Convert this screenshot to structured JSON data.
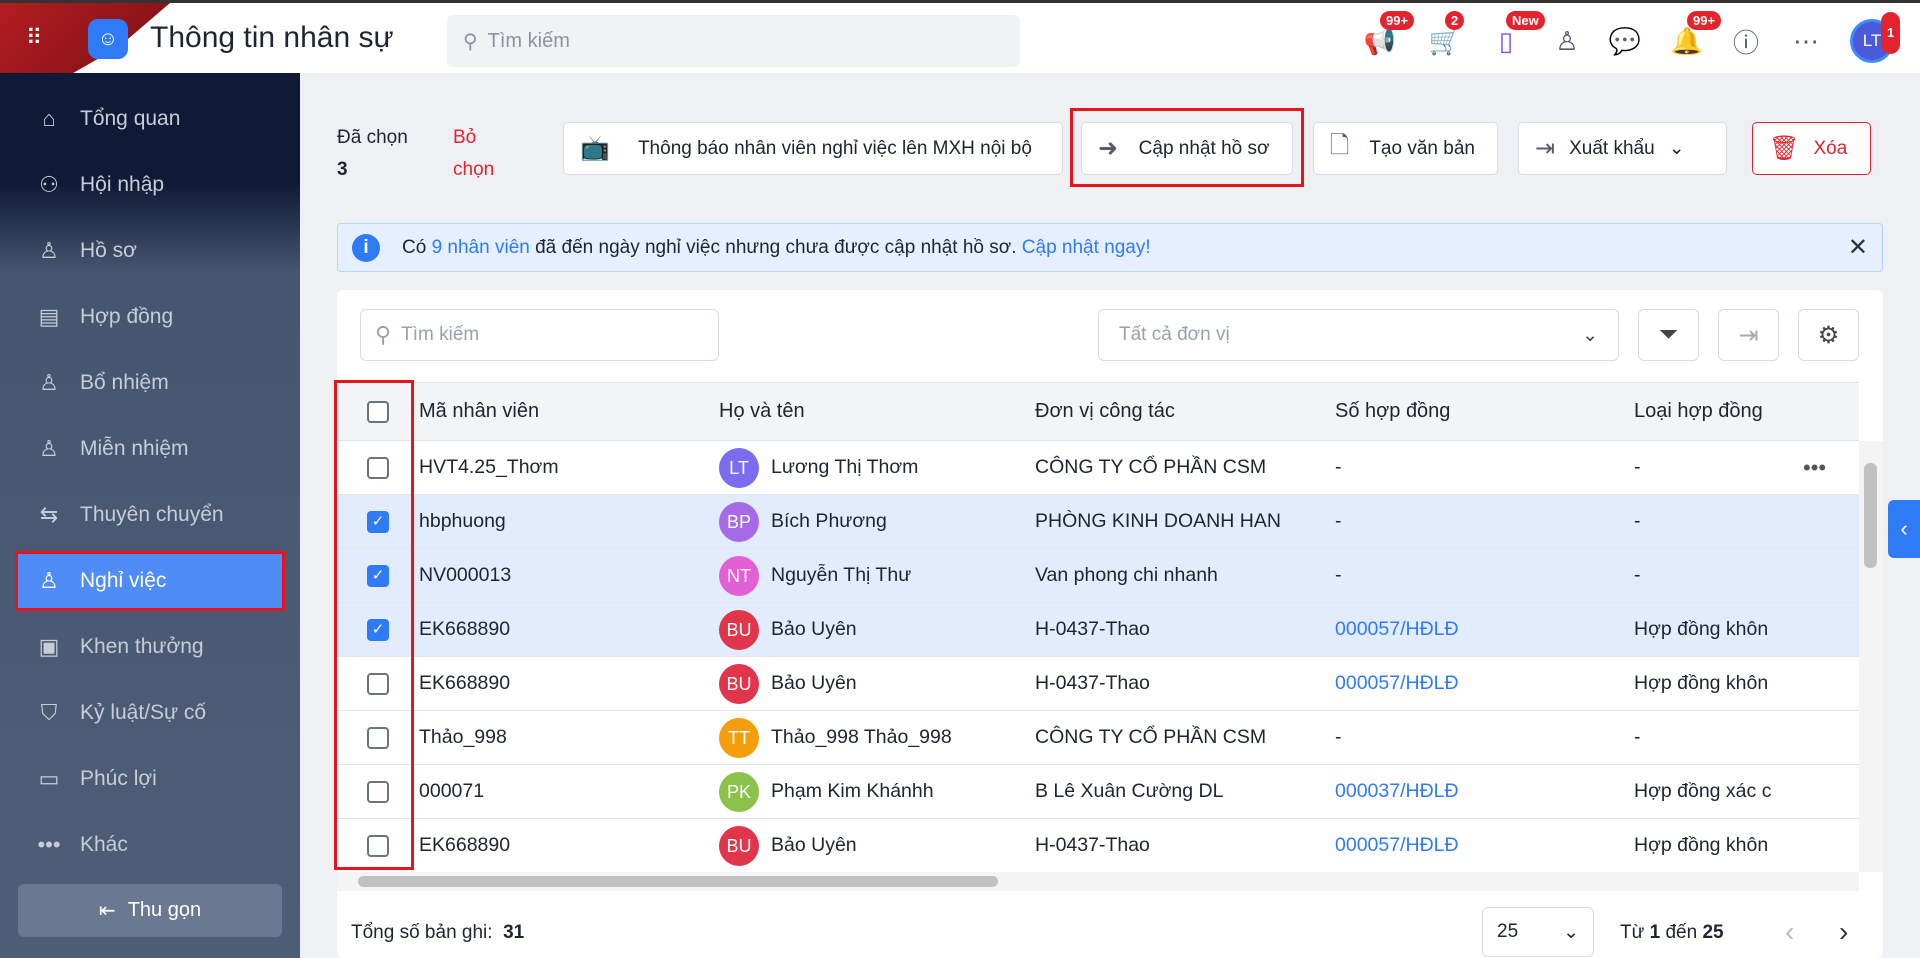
{
  "header": {
    "title": "Thông tin nhân sự",
    "search_placeholder": "Tìm kiếm",
    "badges": {
      "announce": "99+",
      "cart": "2",
      "phone": "New",
      "bell": "99+",
      "avatar": "1"
    },
    "avatar_initials": "LT"
  },
  "sidebar": {
    "items": [
      {
        "label": "Tổng quan",
        "icon": "⌂"
      },
      {
        "label": "Hội nhập",
        "icon": "⚇"
      },
      {
        "label": "Hồ sơ",
        "icon": "♙"
      },
      {
        "label": "Hợp đồng",
        "icon": "▤"
      },
      {
        "label": "Bổ nhiệm",
        "icon": "♙"
      },
      {
        "label": "Miễn nhiệm",
        "icon": "♙"
      },
      {
        "label": "Thuyên chuyển",
        "icon": "⇆"
      },
      {
        "label": "Nghỉ việc",
        "icon": "♙"
      },
      {
        "label": "Khen thưởng",
        "icon": "▣"
      },
      {
        "label": "Kỷ luật/Sự cố",
        "icon": "⛉"
      },
      {
        "label": "Phúc lợi",
        "icon": "▭"
      },
      {
        "label": "Khác",
        "icon": "•••"
      }
    ],
    "active": "Nghỉ việc",
    "collapse": "Thu gọn"
  },
  "toolbar": {
    "selected_label": "Đã chọn",
    "selected_count": "3",
    "deselect": "Bỏ chọn",
    "notify": "Thông báo nhân viên nghỉ việc lên MXH nội bộ",
    "update": "Cập nhật hồ sơ",
    "create_doc": "Tạo văn bản",
    "export": "Xuất khẩu",
    "delete": "Xóa"
  },
  "banner": {
    "pre": "Có",
    "count": "9 nhân viên",
    "mid": "đã đến ngày nghỉ việc nhưng chưa được cập nhật hồ sơ.",
    "link": "Cập nhật ngay!"
  },
  "filters": {
    "search_placeholder": "Tìm kiếm",
    "unit_placeholder": "Tất cả đơn vị"
  },
  "table": {
    "columns": [
      "Mã nhân viên",
      "Họ và tên",
      "Đơn vị công tác",
      "Số hợp đồng",
      "Loại hợp đồng"
    ],
    "rows": [
      {
        "checked": false,
        "code": "HVT4.25_Thơm",
        "initials": "LT",
        "color": "#7b6cf0",
        "name": "Lương Thị Thơm",
        "unit": "CÔNG TY CỔ PHẦN CSM",
        "contract": "-",
        "type": "-"
      },
      {
        "checked": true,
        "code": "hbphuong",
        "initials": "BP",
        "color": "#a56be6",
        "name": "Bích Phương",
        "unit": "PHÒNG KINH DOANH HAN",
        "contract": "-",
        "type": "-"
      },
      {
        "checked": true,
        "code": "NV000013",
        "initials": "NT",
        "color": "#e25fd6",
        "name": "Nguyễn Thị Thư",
        "unit": "Van phong chi nhanh",
        "contract": "-",
        "type": "-"
      },
      {
        "checked": true,
        "code": "EK668890",
        "initials": "BU",
        "color": "#e0354a",
        "name": "Bảo Uyên",
        "unit": "H-0437-Thao",
        "contract": "000057/HĐLĐ",
        "type": "Hợp đồng khôn"
      },
      {
        "checked": false,
        "code": "EK668890",
        "initials": "BU",
        "color": "#e0354a",
        "name": "Bảo Uyên",
        "unit": "H-0437-Thao",
        "contract": "000057/HĐLĐ",
        "type": "Hợp đồng khôn"
      },
      {
        "checked": false,
        "code": "Thảo_998",
        "initials": "TT",
        "color": "#f59e0b",
        "name": "Thảo_998 Thảo_998",
        "unit": "CÔNG TY CỔ PHẦN CSM",
        "contract": "-",
        "type": "-"
      },
      {
        "checked": false,
        "code": "000071",
        "initials": "PK",
        "color": "#8bc34a",
        "name": "Phạm Kim Khánhh",
        "unit": "B Lê Xuân Cường DL",
        "contract": "000037/HĐLĐ",
        "type": "Hợp đồng xác c"
      },
      {
        "checked": false,
        "code": "EK668890",
        "initials": "BU",
        "color": "#e0354a",
        "name": "Bảo Uyên",
        "unit": "H-0437-Thao",
        "contract": "000057/HĐLĐ",
        "type": "Hợp đồng khôn"
      }
    ]
  },
  "footer": {
    "total_label": "Tổng số bản ghi:",
    "total": "31",
    "page_size": "25",
    "range_pre": "Từ",
    "range_from": "1",
    "range_mid": "đến",
    "range_to": "25"
  }
}
